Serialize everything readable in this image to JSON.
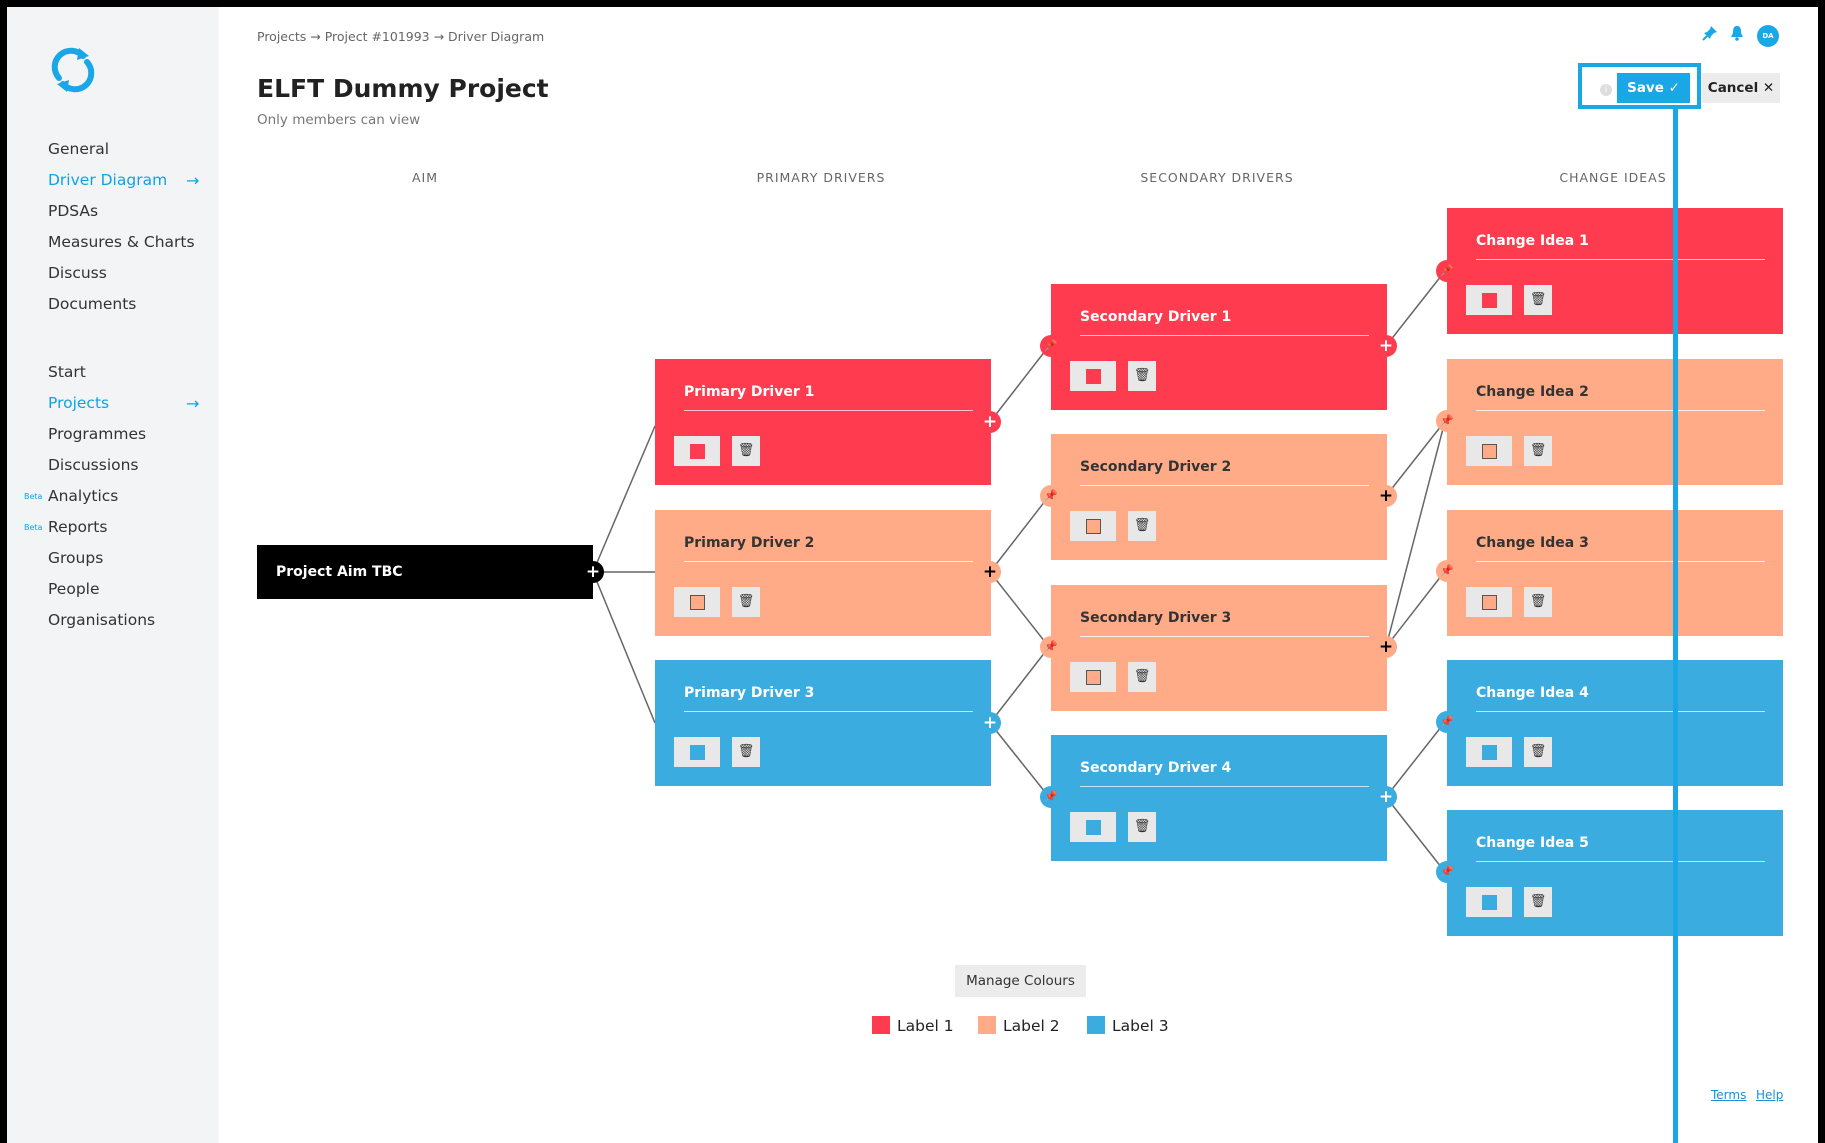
{
  "colors": {
    "label1": "#ff3b50",
    "label2": "#ffab88",
    "label3": "#3bacdf",
    "accent": "#1aa7e6"
  },
  "sidebar": {
    "items": [
      {
        "label": "General"
      },
      {
        "label": "Driver Diagram"
      },
      {
        "label": "PDSAs"
      },
      {
        "label": "Measures & Charts"
      },
      {
        "label": "Discuss"
      },
      {
        "label": "Documents"
      },
      {
        "label": "Start"
      },
      {
        "label": "Projects"
      },
      {
        "label": "Programmes"
      },
      {
        "label": "Discussions"
      },
      {
        "label": "Analytics",
        "badge": "Beta"
      },
      {
        "label": "Reports",
        "badge": "Beta"
      },
      {
        "label": "Groups"
      },
      {
        "label": "People"
      },
      {
        "label": "Organisations"
      }
    ],
    "arrow": "→"
  },
  "header": {
    "breadcrumb": "Projects → Project #101993 → Driver Diagram",
    "title": "ELFT Dummy Project",
    "subtitle": "Only members can view",
    "avatar": "DA",
    "info_icon": "i",
    "save_label": "Save ✓",
    "cancel_label": "Cancel ✕"
  },
  "columns": [
    "AIM",
    "PRIMARY DRIVERS",
    "SECONDARY DRIVERS",
    "CHANGE IDEAS"
  ],
  "aim": {
    "label": "Project Aim TBC"
  },
  "primary": [
    {
      "title": "Primary Driver 1",
      "label": 1
    },
    {
      "title": "Primary Driver 2",
      "label": 2
    },
    {
      "title": "Primary Driver 3",
      "label": 3
    }
  ],
  "secondary": [
    {
      "title": "Secondary Driver 1",
      "label": 1
    },
    {
      "title": "Secondary Driver 2",
      "label": 2
    },
    {
      "title": "Secondary Driver 3",
      "label": 2
    },
    {
      "title": "Secondary Driver 4",
      "label": 3
    }
  ],
  "ideas": [
    {
      "title": "Change Idea 1",
      "label": 1
    },
    {
      "title": "Change Idea 2",
      "label": 2
    },
    {
      "title": "Change Idea 3",
      "label": 2
    },
    {
      "title": "Change Idea 4",
      "label": 3
    },
    {
      "title": "Change Idea 5",
      "label": 3
    }
  ],
  "manage_colours": "Manage Colours",
  "legend": [
    {
      "label": "Label 1"
    },
    {
      "label": "Label 2"
    },
    {
      "label": "Label 3"
    }
  ],
  "footer": {
    "terms": "Terms",
    "help": "Help"
  }
}
